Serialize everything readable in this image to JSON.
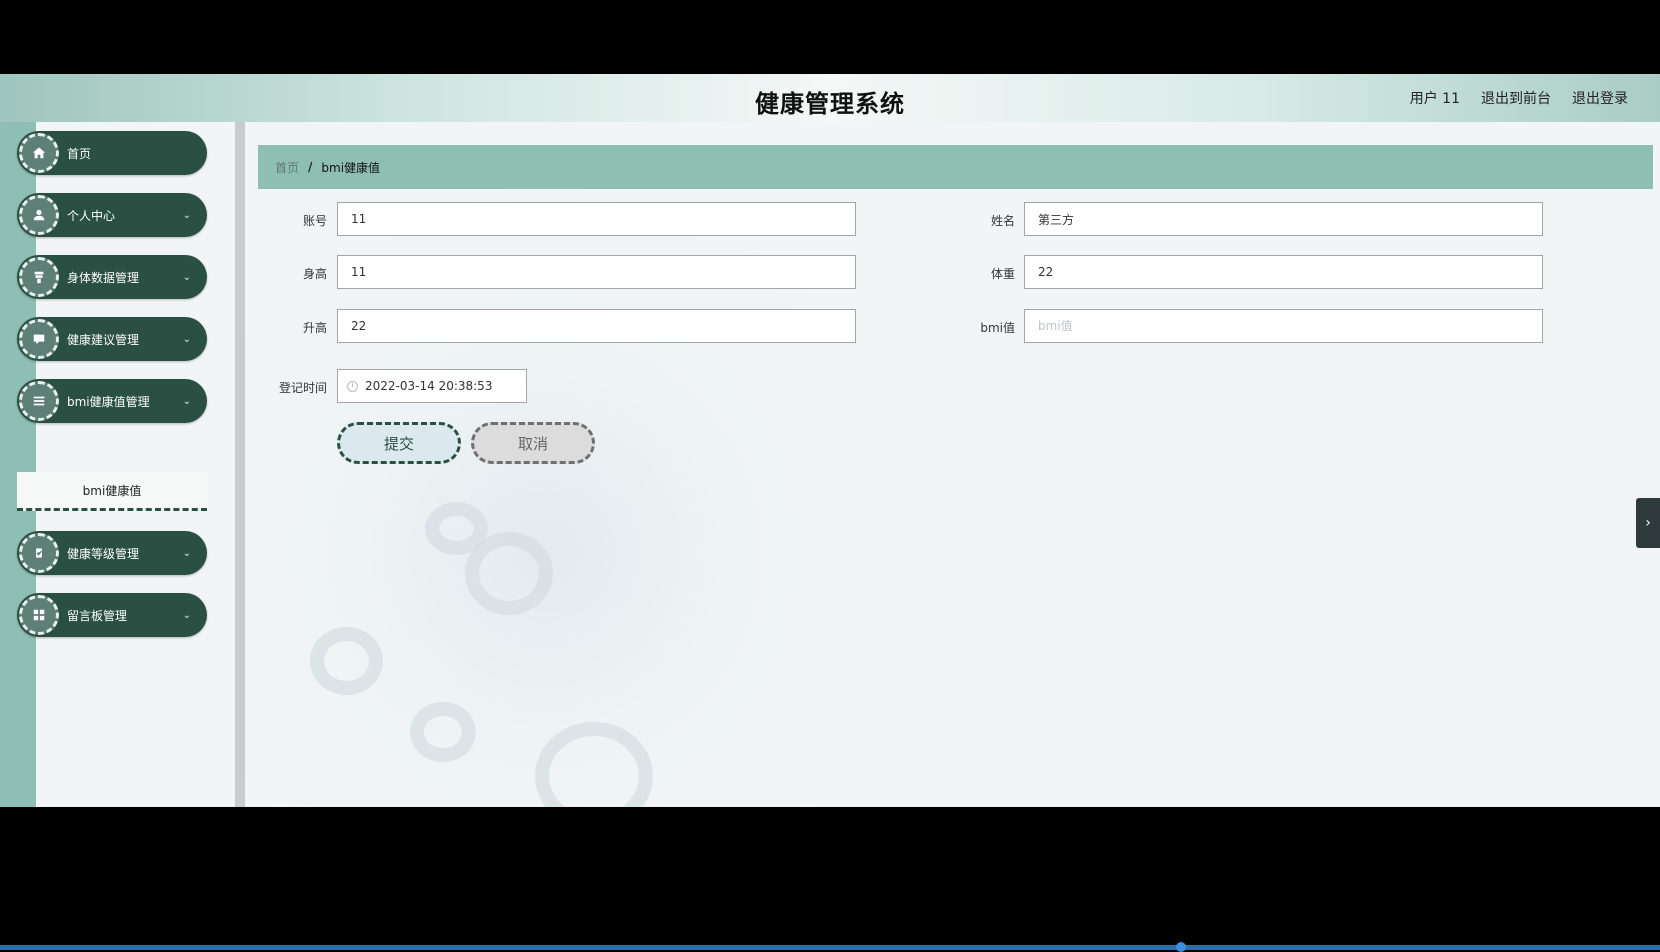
{
  "header": {
    "title": "健康管理系统",
    "user_label": "用户 11",
    "exit_to_front": "退出到前台",
    "logout": "退出登录"
  },
  "sidebar": {
    "items": [
      {
        "label": "首页",
        "icon": "home-icon"
      },
      {
        "label": "个人中心",
        "icon": "user-icon"
      },
      {
        "label": "身体数据管理",
        "icon": "body-data-icon"
      },
      {
        "label": "健康建议管理",
        "icon": "chat-icon"
      },
      {
        "label": "bmi健康值管理",
        "icon": "list-icon"
      },
      {
        "label": "健康等级管理",
        "icon": "clipboard-icon"
      },
      {
        "label": "留言板管理",
        "icon": "grid-icon"
      }
    ],
    "submenu": {
      "label": "bmi健康值"
    }
  },
  "breadcrumb": {
    "home": "首页",
    "separator": "/",
    "current": "bmi健康值"
  },
  "form": {
    "account": {
      "label": "账号",
      "value": "11"
    },
    "name": {
      "label": "姓名",
      "value": "第三方"
    },
    "height": {
      "label": "身高",
      "value": "11"
    },
    "weight": {
      "label": "体重",
      "value": "22"
    },
    "rise": {
      "label": "升高",
      "value": "22"
    },
    "bmi": {
      "label": "bmi值",
      "value": "",
      "placeholder": "bmi值"
    },
    "register_time": {
      "label": "登记时间",
      "value": "2022-03-14 20:38:53"
    },
    "submit": "提交",
    "cancel": "取消"
  },
  "colors": {
    "sidebar_menu": "#2a4f43",
    "breadcrumb_bar": "#8fbfb3",
    "accent_stripe": "#8fbeb4"
  }
}
